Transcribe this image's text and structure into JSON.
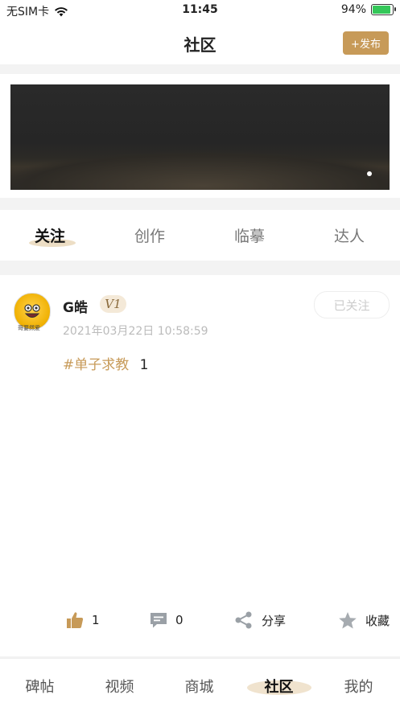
{
  "status_bar": {
    "carrier": "无SIM卡",
    "time": "11:45",
    "battery": "94%",
    "battery_level": 0.94
  },
  "header": {
    "title": "社区",
    "publish_label": "+发布"
  },
  "banner": {
    "page_indicator_count": 1
  },
  "tabs": [
    {
      "label": "关注",
      "active": true
    },
    {
      "label": "创作",
      "active": false
    },
    {
      "label": "临摹",
      "active": false
    },
    {
      "label": "达人",
      "active": false
    }
  ],
  "post": {
    "username": "G皓",
    "badge": "V1",
    "follow_label": "已关注",
    "avatar_caption": "哥要然爱",
    "timestamp": "2021年03月22日 10:58:59",
    "hashtag": "#单子求教",
    "text": "1",
    "like_count": "1",
    "comment_count": "0",
    "share_label": "分享",
    "collect_label": "收藏"
  },
  "bottom_nav": [
    {
      "label": "碑帖",
      "active": false
    },
    {
      "label": "视频",
      "active": false
    },
    {
      "label": "商城",
      "active": false
    },
    {
      "label": "社区",
      "active": true
    },
    {
      "label": "我的",
      "active": false
    }
  ],
  "colors": {
    "accent": "#c79a58",
    "battery_green": "#34c759"
  },
  "icons": {
    "wifi": "wifi-icon",
    "like": "thumbs-up-icon",
    "comment": "comment-icon",
    "share": "share-icon",
    "collect": "star-icon"
  }
}
